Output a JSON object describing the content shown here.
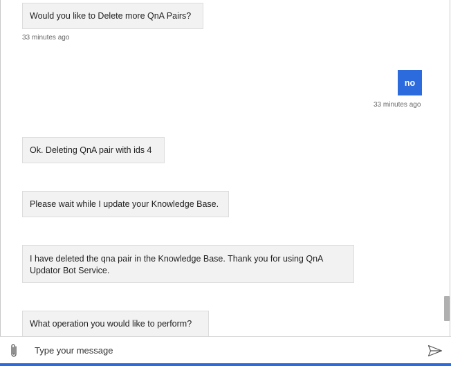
{
  "messages": [
    {
      "from": "bot",
      "text": "Would you like to Delete more QnA Pairs?",
      "time": "33 minutes ago"
    },
    {
      "from": "user",
      "text": "no",
      "time": "33 minutes ago"
    },
    {
      "from": "bot",
      "text": "Ok. Deleting QnA pair with ids 4"
    },
    {
      "from": "bot",
      "text": "Please wait while I update your Knowledge Base."
    },
    {
      "from": "bot",
      "text": "I have deleted the qna pair in the Knowledge Base. Thank you for using QnA Updator Bot Service."
    },
    {
      "from": "bot",
      "text": "What operation you would like to perform?"
    }
  ],
  "input": {
    "placeholder": "Type your message",
    "value": ""
  },
  "icons": {
    "attach": "paperclip-icon",
    "send": "send-icon"
  },
  "colors": {
    "accent": "#2c6bdd",
    "bot_bubble": "#f2f2f2"
  }
}
